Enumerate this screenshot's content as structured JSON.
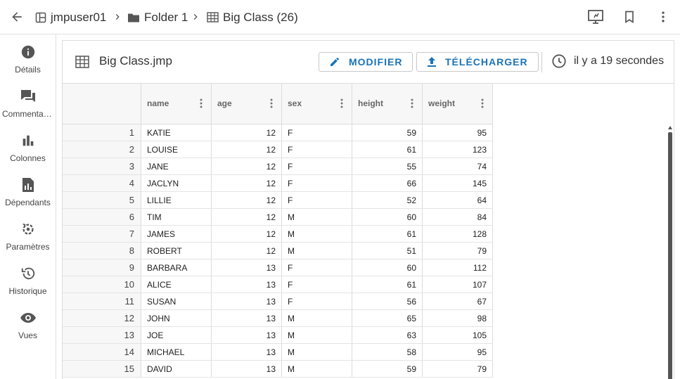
{
  "breadcrumb": {
    "user": "jmpuser01",
    "folder": "Folder 1",
    "table": "Big Class (26)"
  },
  "rail": [
    {
      "label": "Détails",
      "icon": "info-icon"
    },
    {
      "label": "Commentaires",
      "icon": "comments-icon"
    },
    {
      "label": "Colonnes",
      "icon": "bar-chart-icon"
    },
    {
      "label": "Dépendants",
      "icon": "dependents-icon"
    },
    {
      "label": "Paramètres",
      "icon": "settings-icon"
    },
    {
      "label": "Historique",
      "icon": "history-icon"
    },
    {
      "label": "Vues",
      "icon": "eye-icon"
    }
  ],
  "panel": {
    "title": "Big Class.jmp",
    "edit_label": "MODIFIER",
    "download_label": "TÉLÉCHARGER",
    "timestamp": "il y a 19 secondes"
  },
  "columns": [
    "name",
    "age",
    "sex",
    "height",
    "weight"
  ],
  "rows": [
    {
      "n": "1",
      "name": "KATIE",
      "age": "12",
      "sex": "F",
      "height": "59",
      "weight": "95"
    },
    {
      "n": "2",
      "name": "LOUISE",
      "age": "12",
      "sex": "F",
      "height": "61",
      "weight": "123"
    },
    {
      "n": "3",
      "name": "JANE",
      "age": "12",
      "sex": "F",
      "height": "55",
      "weight": "74"
    },
    {
      "n": "4",
      "name": "JACLYN",
      "age": "12",
      "sex": "F",
      "height": "66",
      "weight": "145"
    },
    {
      "n": "5",
      "name": "LILLIE",
      "age": "12",
      "sex": "F",
      "height": "52",
      "weight": "64"
    },
    {
      "n": "6",
      "name": "TIM",
      "age": "12",
      "sex": "M",
      "height": "60",
      "weight": "84"
    },
    {
      "n": "7",
      "name": "JAMES",
      "age": "12",
      "sex": "M",
      "height": "61",
      "weight": "128"
    },
    {
      "n": "8",
      "name": "ROBERT",
      "age": "12",
      "sex": "M",
      "height": "51",
      "weight": "79"
    },
    {
      "n": "9",
      "name": "BARBARA",
      "age": "13",
      "sex": "F",
      "height": "60",
      "weight": "112"
    },
    {
      "n": "10",
      "name": "ALICE",
      "age": "13",
      "sex": "F",
      "height": "61",
      "weight": "107"
    },
    {
      "n": "11",
      "name": "SUSAN",
      "age": "13",
      "sex": "F",
      "height": "56",
      "weight": "67"
    },
    {
      "n": "12",
      "name": "JOHN",
      "age": "13",
      "sex": "M",
      "height": "65",
      "weight": "98"
    },
    {
      "n": "13",
      "name": "JOE",
      "age": "13",
      "sex": "M",
      "height": "63",
      "weight": "105"
    },
    {
      "n": "14",
      "name": "MICHAEL",
      "age": "13",
      "sex": "M",
      "height": "58",
      "weight": "95"
    },
    {
      "n": "15",
      "name": "DAVID",
      "age": "13",
      "sex": "M",
      "height": "59",
      "weight": "79"
    }
  ],
  "colors": {
    "accent": "#1a73b8",
    "text": "#212121",
    "border": "#dcdcdc"
  }
}
